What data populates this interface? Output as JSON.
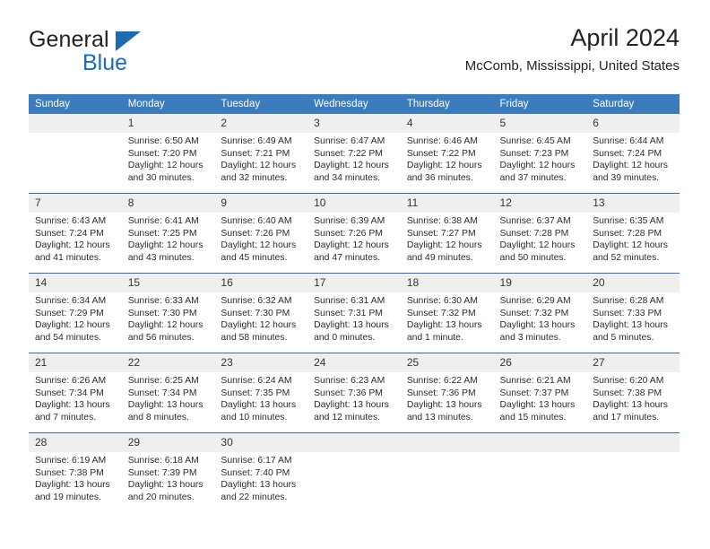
{
  "logo": {
    "word_one": "General",
    "word_two": "Blue",
    "triangle_color": "#1c6cb5"
  },
  "header": {
    "title": "April 2024",
    "subtitle": "McComb, Mississippi, United States"
  },
  "theme": {
    "header_row_bg": "#3a7cbe",
    "week_divider": "#2f6fb0",
    "daynum_bg": "#efefef",
    "text": "#222222"
  },
  "weekday_headers": [
    "Sunday",
    "Monday",
    "Tuesday",
    "Wednesday",
    "Thursday",
    "Friday",
    "Saturday"
  ],
  "labels": {
    "sunrise_prefix": "Sunrise:",
    "sunset_prefix": "Sunset:",
    "daylight_prefix": "Daylight:"
  },
  "weeks": [
    [
      {
        "day": "",
        "sunrise": "",
        "sunset": "",
        "daylight_line1": "",
        "daylight_line2": ""
      },
      {
        "day": "1",
        "sunrise": "Sunrise: 6:50 AM",
        "sunset": "Sunset: 7:20 PM",
        "daylight_line1": "Daylight: 12 hours",
        "daylight_line2": "and 30 minutes."
      },
      {
        "day": "2",
        "sunrise": "Sunrise: 6:49 AM",
        "sunset": "Sunset: 7:21 PM",
        "daylight_line1": "Daylight: 12 hours",
        "daylight_line2": "and 32 minutes."
      },
      {
        "day": "3",
        "sunrise": "Sunrise: 6:47 AM",
        "sunset": "Sunset: 7:22 PM",
        "daylight_line1": "Daylight: 12 hours",
        "daylight_line2": "and 34 minutes."
      },
      {
        "day": "4",
        "sunrise": "Sunrise: 6:46 AM",
        "sunset": "Sunset: 7:22 PM",
        "daylight_line1": "Daylight: 12 hours",
        "daylight_line2": "and 36 minutes."
      },
      {
        "day": "5",
        "sunrise": "Sunrise: 6:45 AM",
        "sunset": "Sunset: 7:23 PM",
        "daylight_line1": "Daylight: 12 hours",
        "daylight_line2": "and 37 minutes."
      },
      {
        "day": "6",
        "sunrise": "Sunrise: 6:44 AM",
        "sunset": "Sunset: 7:24 PM",
        "daylight_line1": "Daylight: 12 hours",
        "daylight_line2": "and 39 minutes."
      }
    ],
    [
      {
        "day": "7",
        "sunrise": "Sunrise: 6:43 AM",
        "sunset": "Sunset: 7:24 PM",
        "daylight_line1": "Daylight: 12 hours",
        "daylight_line2": "and 41 minutes."
      },
      {
        "day": "8",
        "sunrise": "Sunrise: 6:41 AM",
        "sunset": "Sunset: 7:25 PM",
        "daylight_line1": "Daylight: 12 hours",
        "daylight_line2": "and 43 minutes."
      },
      {
        "day": "9",
        "sunrise": "Sunrise: 6:40 AM",
        "sunset": "Sunset: 7:26 PM",
        "daylight_line1": "Daylight: 12 hours",
        "daylight_line2": "and 45 minutes."
      },
      {
        "day": "10",
        "sunrise": "Sunrise: 6:39 AM",
        "sunset": "Sunset: 7:26 PM",
        "daylight_line1": "Daylight: 12 hours",
        "daylight_line2": "and 47 minutes."
      },
      {
        "day": "11",
        "sunrise": "Sunrise: 6:38 AM",
        "sunset": "Sunset: 7:27 PM",
        "daylight_line1": "Daylight: 12 hours",
        "daylight_line2": "and 49 minutes."
      },
      {
        "day": "12",
        "sunrise": "Sunrise: 6:37 AM",
        "sunset": "Sunset: 7:28 PM",
        "daylight_line1": "Daylight: 12 hours",
        "daylight_line2": "and 50 minutes."
      },
      {
        "day": "13",
        "sunrise": "Sunrise: 6:35 AM",
        "sunset": "Sunset: 7:28 PM",
        "daylight_line1": "Daylight: 12 hours",
        "daylight_line2": "and 52 minutes."
      }
    ],
    [
      {
        "day": "14",
        "sunrise": "Sunrise: 6:34 AM",
        "sunset": "Sunset: 7:29 PM",
        "daylight_line1": "Daylight: 12 hours",
        "daylight_line2": "and 54 minutes."
      },
      {
        "day": "15",
        "sunrise": "Sunrise: 6:33 AM",
        "sunset": "Sunset: 7:30 PM",
        "daylight_line1": "Daylight: 12 hours",
        "daylight_line2": "and 56 minutes."
      },
      {
        "day": "16",
        "sunrise": "Sunrise: 6:32 AM",
        "sunset": "Sunset: 7:30 PM",
        "daylight_line1": "Daylight: 12 hours",
        "daylight_line2": "and 58 minutes."
      },
      {
        "day": "17",
        "sunrise": "Sunrise: 6:31 AM",
        "sunset": "Sunset: 7:31 PM",
        "daylight_line1": "Daylight: 13 hours",
        "daylight_line2": "and 0 minutes."
      },
      {
        "day": "18",
        "sunrise": "Sunrise: 6:30 AM",
        "sunset": "Sunset: 7:32 PM",
        "daylight_line1": "Daylight: 13 hours",
        "daylight_line2": "and 1 minute."
      },
      {
        "day": "19",
        "sunrise": "Sunrise: 6:29 AM",
        "sunset": "Sunset: 7:32 PM",
        "daylight_line1": "Daylight: 13 hours",
        "daylight_line2": "and 3 minutes."
      },
      {
        "day": "20",
        "sunrise": "Sunrise: 6:28 AM",
        "sunset": "Sunset: 7:33 PM",
        "daylight_line1": "Daylight: 13 hours",
        "daylight_line2": "and 5 minutes."
      }
    ],
    [
      {
        "day": "21",
        "sunrise": "Sunrise: 6:26 AM",
        "sunset": "Sunset: 7:34 PM",
        "daylight_line1": "Daylight: 13 hours",
        "daylight_line2": "and 7 minutes."
      },
      {
        "day": "22",
        "sunrise": "Sunrise: 6:25 AM",
        "sunset": "Sunset: 7:34 PM",
        "daylight_line1": "Daylight: 13 hours",
        "daylight_line2": "and 8 minutes."
      },
      {
        "day": "23",
        "sunrise": "Sunrise: 6:24 AM",
        "sunset": "Sunset: 7:35 PM",
        "daylight_line1": "Daylight: 13 hours",
        "daylight_line2": "and 10 minutes."
      },
      {
        "day": "24",
        "sunrise": "Sunrise: 6:23 AM",
        "sunset": "Sunset: 7:36 PM",
        "daylight_line1": "Daylight: 13 hours",
        "daylight_line2": "and 12 minutes."
      },
      {
        "day": "25",
        "sunrise": "Sunrise: 6:22 AM",
        "sunset": "Sunset: 7:36 PM",
        "daylight_line1": "Daylight: 13 hours",
        "daylight_line2": "and 13 minutes."
      },
      {
        "day": "26",
        "sunrise": "Sunrise: 6:21 AM",
        "sunset": "Sunset: 7:37 PM",
        "daylight_line1": "Daylight: 13 hours",
        "daylight_line2": "and 15 minutes."
      },
      {
        "day": "27",
        "sunrise": "Sunrise: 6:20 AM",
        "sunset": "Sunset: 7:38 PM",
        "daylight_line1": "Daylight: 13 hours",
        "daylight_line2": "and 17 minutes."
      }
    ],
    [
      {
        "day": "28",
        "sunrise": "Sunrise: 6:19 AM",
        "sunset": "Sunset: 7:38 PM",
        "daylight_line1": "Daylight: 13 hours",
        "daylight_line2": "and 19 minutes."
      },
      {
        "day": "29",
        "sunrise": "Sunrise: 6:18 AM",
        "sunset": "Sunset: 7:39 PM",
        "daylight_line1": "Daylight: 13 hours",
        "daylight_line2": "and 20 minutes."
      },
      {
        "day": "30",
        "sunrise": "Sunrise: 6:17 AM",
        "sunset": "Sunset: 7:40 PM",
        "daylight_line1": "Daylight: 13 hours",
        "daylight_line2": "and 22 minutes."
      },
      {
        "day": "",
        "sunrise": "",
        "sunset": "",
        "daylight_line1": "",
        "daylight_line2": ""
      },
      {
        "day": "",
        "sunrise": "",
        "sunset": "",
        "daylight_line1": "",
        "daylight_line2": ""
      },
      {
        "day": "",
        "sunrise": "",
        "sunset": "",
        "daylight_line1": "",
        "daylight_line2": ""
      },
      {
        "day": "",
        "sunrise": "",
        "sunset": "",
        "daylight_line1": "",
        "daylight_line2": ""
      }
    ]
  ]
}
